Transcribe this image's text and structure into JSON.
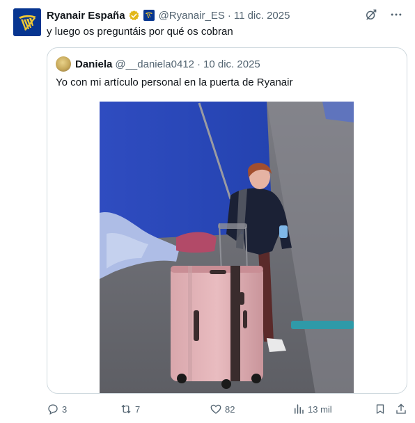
{
  "tweet": {
    "display_name": "Ryanair España",
    "handle": "@Ryanair_ES",
    "separator": "·",
    "time": "11 dic. 2025",
    "text": "y luego os preguntáis por qué os cobran",
    "icons": {
      "verified": "verified-badge-icon",
      "affiliate": "ryanair-affiliate-badge-icon",
      "grok": "grok-icon",
      "more": "more-icon"
    },
    "colors": {
      "brand": "#073590",
      "brand_accent": "#f1c933",
      "verified": "#e2b719"
    }
  },
  "quote": {
    "display_name": "Daniela",
    "handle": "@__daniela0412",
    "separator": "·",
    "time": "10 dic. 2025",
    "text": "Yo con mi artículo personal en la puerta de Ryanair",
    "media": "photo-woman-with-pink-suitcase"
  },
  "actions": {
    "replies": "3",
    "reposts": "7",
    "likes": "82",
    "views": "13 mil"
  }
}
